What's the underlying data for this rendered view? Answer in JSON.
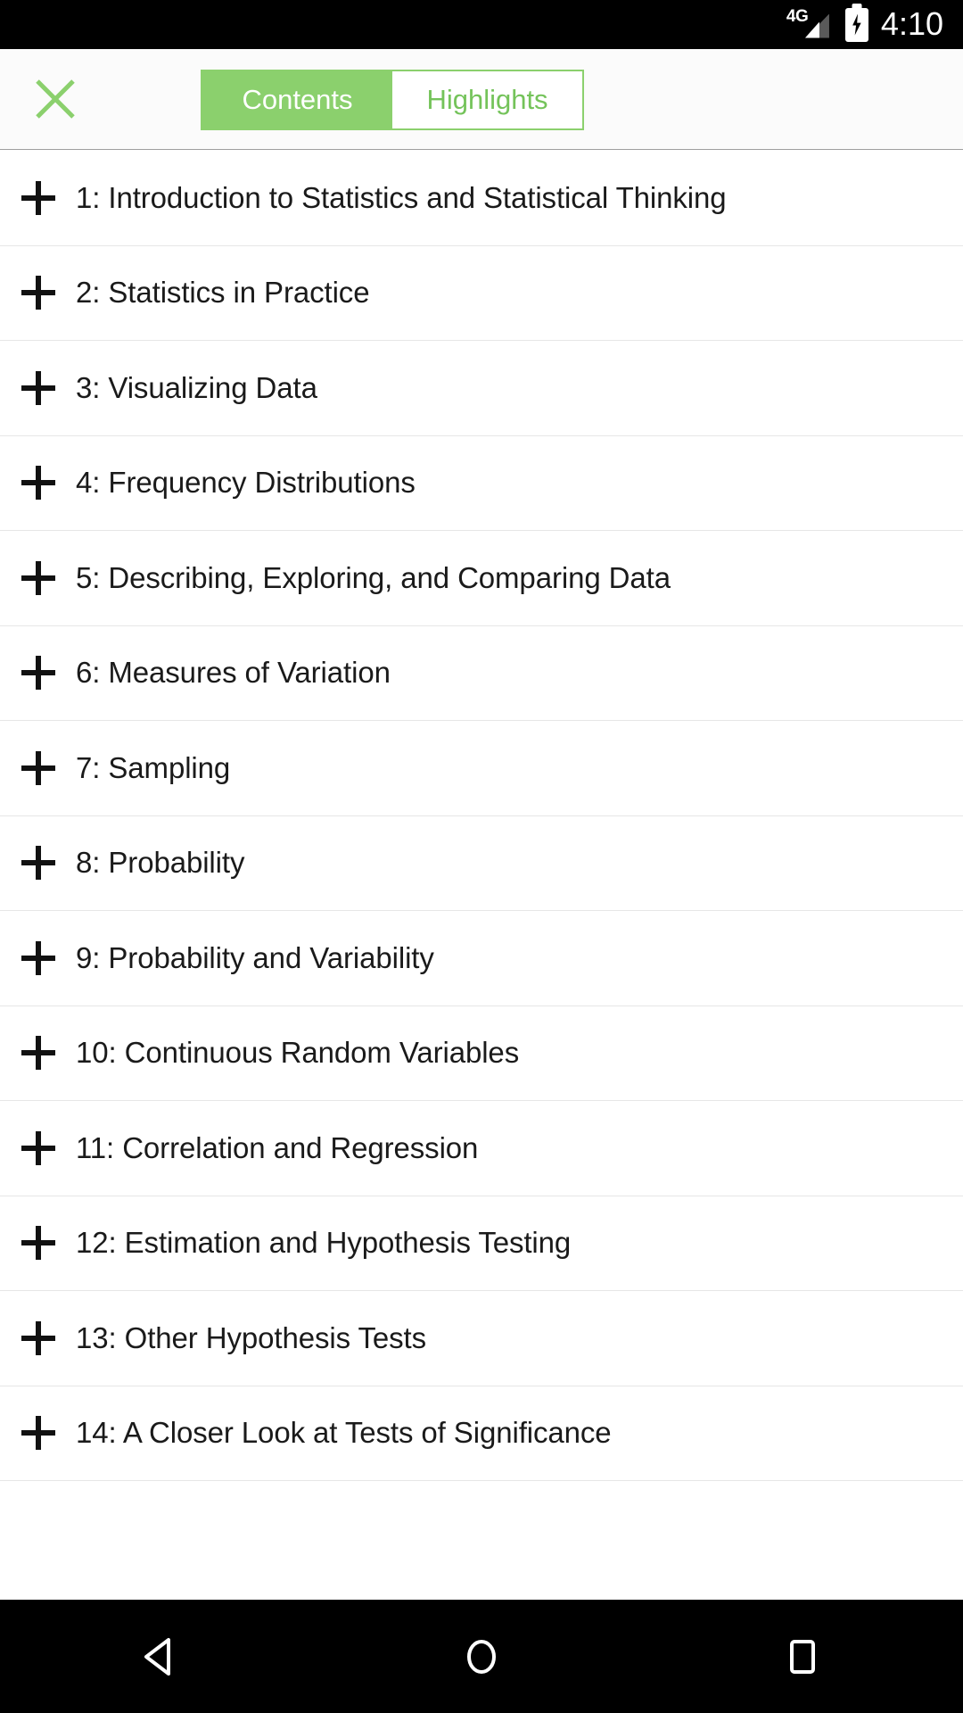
{
  "status_bar": {
    "network_label": "4G",
    "signal_icon": "signal-bars-icon",
    "battery_icon": "battery-charging-icon",
    "time": "4:10"
  },
  "header": {
    "close_icon": "close-x-icon",
    "accent_color": "#8bd06d",
    "tabs": [
      {
        "label": "Contents",
        "active": true
      },
      {
        "label": "Highlights",
        "active": false
      }
    ]
  },
  "list": {
    "expand_icon": "plus-icon",
    "items": [
      {
        "label": "1: Introduction to Statistics and Statistical Thinking"
      },
      {
        "label": "2: Statistics in Practice"
      },
      {
        "label": "3: Visualizing Data"
      },
      {
        "label": "4: Frequency Distributions"
      },
      {
        "label": "5: Describing, Exploring, and Comparing Data"
      },
      {
        "label": "6: Measures of Variation"
      },
      {
        "label": "7: Sampling"
      },
      {
        "label": "8: Probability"
      },
      {
        "label": "9: Probability and Variability"
      },
      {
        "label": "10: Continuous Random Variables"
      },
      {
        "label": "11: Correlation and Regression"
      },
      {
        "label": "12: Estimation and Hypothesis Testing"
      },
      {
        "label": "13: Other Hypothesis Tests"
      },
      {
        "label": "14: A Closer Look at Tests of Significance"
      }
    ]
  },
  "nav_bar": {
    "back_icon": "back-triangle-icon",
    "home_icon": "home-circle-icon",
    "recents_icon": "recents-square-icon"
  }
}
